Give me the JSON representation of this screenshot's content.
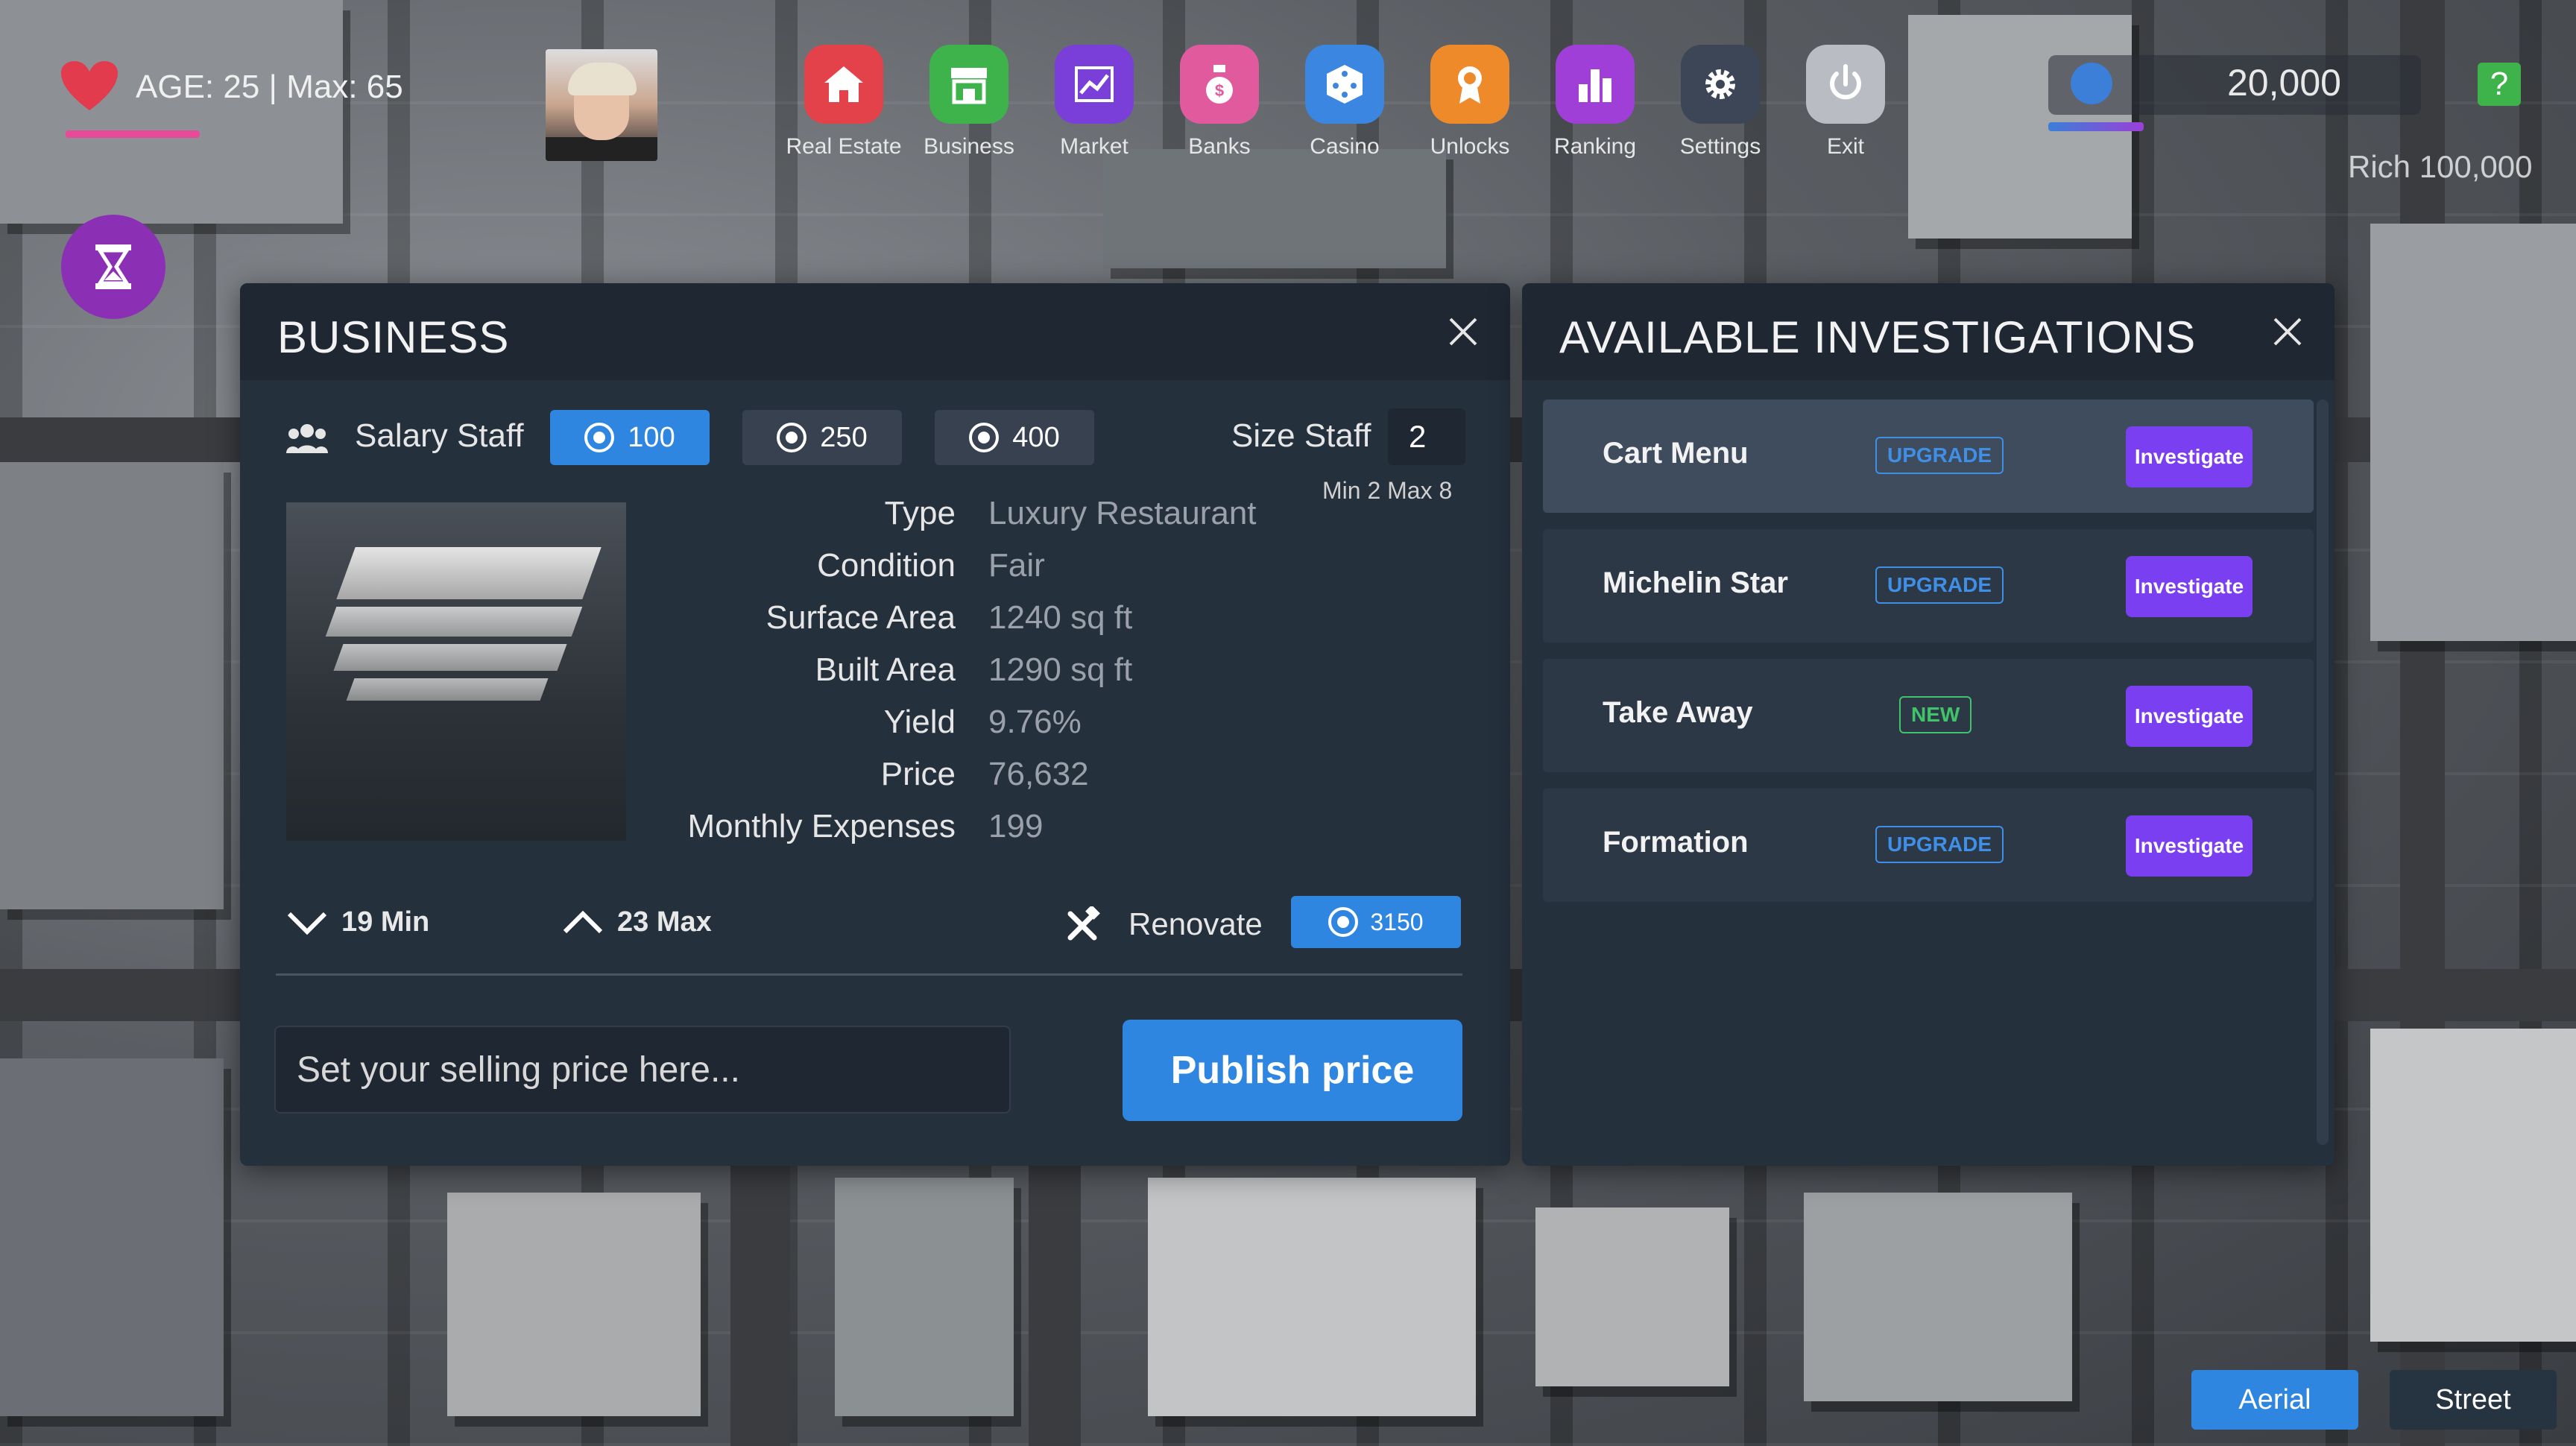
{
  "hud": {
    "age_text": "AGE: 25 | Max: 65",
    "money": "20,000",
    "help_label": "?",
    "rank_text": "Rich  100,000"
  },
  "menu": [
    {
      "label": "Real Estate",
      "icon": "house-icon",
      "color": "#e4424a"
    },
    {
      "label": "Business",
      "icon": "store-icon",
      "color": "#3eb24b"
    },
    {
      "label": "Market",
      "icon": "chart-icon",
      "color": "#7a3fd8"
    },
    {
      "label": "Banks",
      "icon": "moneybag-icon",
      "color": "#e25a9e"
    },
    {
      "label": "Casino",
      "icon": "dice-icon",
      "color": "#3a86e0"
    },
    {
      "label": "Unlocks",
      "icon": "award-icon",
      "color": "#ef8a2a"
    },
    {
      "label": "Ranking",
      "icon": "bar-chart-icon",
      "color": "#a03fd8"
    },
    {
      "label": "Settings",
      "icon": "gear-icon",
      "color": "#3c4656"
    },
    {
      "label": "Exit",
      "icon": "power-icon",
      "color": "#b9bdc3"
    }
  ],
  "business": {
    "title": "BUSINESS",
    "salary_label": "Salary Staff",
    "salary_options": [
      "100",
      "250",
      "400"
    ],
    "salary_selected": "100",
    "size_label": "Size Staff",
    "size_value": "2",
    "size_hint": "Min 2 Max 8",
    "info": [
      {
        "label": "Type",
        "value": "Luxury Restaurant"
      },
      {
        "label": "Condition",
        "value": "Fair"
      },
      {
        "label": "Surface Area",
        "value": "1240 sq ft"
      },
      {
        "label": "Built Area",
        "value": "1290 sq ft"
      },
      {
        "label": "Yield",
        "value": "9.76%"
      },
      {
        "label": "Price",
        "value": "76,632"
      },
      {
        "label": "Monthly Expenses",
        "value": "199"
      }
    ],
    "min_label": "19 Min",
    "max_label": "23 Max",
    "renovate_label": "Renovate",
    "renovate_cost": "3150",
    "price_placeholder": "Set your selling price here...",
    "publish_label": "Publish price"
  },
  "investigations": {
    "title": "AVAILABLE INVESTIGATIONS",
    "items": [
      {
        "name": "Cart Menu",
        "tag": "UPGRADE",
        "button": "Investigate"
      },
      {
        "name": "Michelin Star",
        "tag": "UPGRADE",
        "button": "Investigate"
      },
      {
        "name": "Take Away",
        "tag": "NEW",
        "button": "Investigate"
      },
      {
        "name": "Formation",
        "tag": "UPGRADE",
        "button": "Investigate"
      }
    ]
  },
  "view": {
    "aerial_label": "Aerial",
    "street_label": "Street"
  }
}
